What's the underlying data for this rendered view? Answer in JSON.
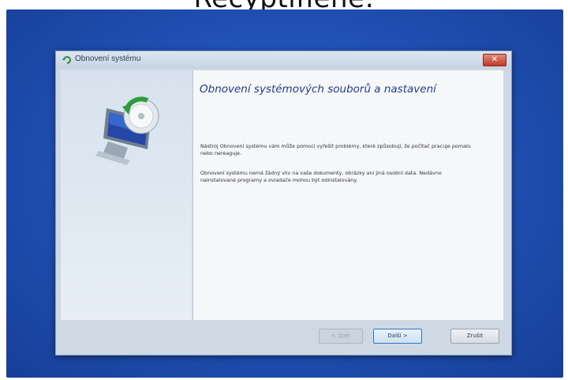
{
  "caption": "Recyptifiené:",
  "window": {
    "title": "Obnovení systému",
    "close_symbol": "✕"
  },
  "content": {
    "heading": "Obnovení systémových souborů a nastavení",
    "paragraph1": "Nástroj Obnovení systému vám může pomoci vyřešit problémy, které způsobují, že počítač pracuje pomalu nebo nereaguje.",
    "paragraph2": "Obnovení systému nemá žádný vliv na vaše dokumenty, obrázky ani jiná osobní data. Nedávno nainstalované programy a ovladače mohou být odinstalovány."
  },
  "buttons": {
    "back": "< Zpět",
    "next": "Další >",
    "cancel": "Zrušit"
  },
  "icons": {
    "title": "system-restore-icon",
    "illustration": "computer-restore-icon"
  },
  "colors": {
    "desktop": "#1f4fb2",
    "heading": "#1f3e8a",
    "close": "#c0392b"
  }
}
